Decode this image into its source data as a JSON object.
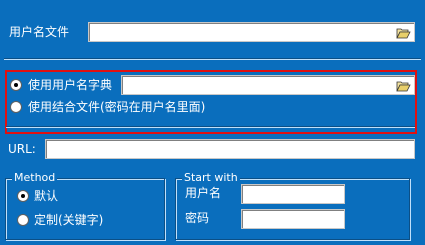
{
  "user_file": {
    "label": "用户名文件",
    "value": "",
    "browse_icon": "folder-open-icon"
  },
  "dictionary": {
    "use_dict_label": "使用用户名字典",
    "use_dict_selected": true,
    "dict_value": "",
    "browse_icon": "folder-open-icon",
    "use_combined_label": "使用结合文件(密码在用户名里面)",
    "use_combined_selected": false
  },
  "url": {
    "label": "URL:",
    "value": ""
  },
  "method": {
    "title": "Method",
    "option_default": "默认",
    "option_default_selected": true,
    "option_custom": "定制(关键字)",
    "option_custom_selected": false
  },
  "start_with": {
    "title": "Start with",
    "username_label": "用户名",
    "username_value": "",
    "password_label": "密码",
    "password_value": ""
  },
  "colors": {
    "background": "#0a6ebd",
    "highlight": "#e01010"
  }
}
